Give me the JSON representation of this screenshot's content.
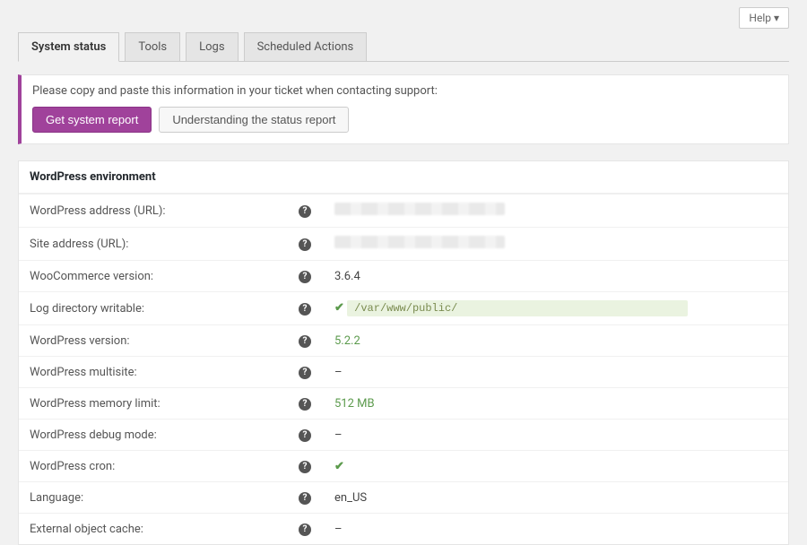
{
  "help_label": "Help ▾",
  "tabs": {
    "system_status": "System status",
    "tools": "Tools",
    "logs": "Logs",
    "scheduled_actions": "Scheduled Actions"
  },
  "notice": {
    "text": "Please copy and paste this information in your ticket when contacting support:",
    "get_report": "Get system report",
    "understanding": "Understanding the status report"
  },
  "panel_title": "WordPress environment",
  "rows": {
    "wp_address": {
      "label": "WordPress address (URL):",
      "value": ""
    },
    "site_address": {
      "label": "Site address (URL):",
      "value": ""
    },
    "wc_version": {
      "label": "WooCommerce version:",
      "value": "3.6.4"
    },
    "log_dir": {
      "label": "Log directory writable:",
      "value": "/var/www/public/"
    },
    "wp_version": {
      "label": "WordPress version:",
      "value": "5.2.2"
    },
    "wp_multisite": {
      "label": "WordPress multisite:",
      "value": "–"
    },
    "wp_memory": {
      "label": "WordPress memory limit:",
      "value": "512 MB"
    },
    "wp_debug": {
      "label": "WordPress debug mode:",
      "value": "–"
    },
    "wp_cron": {
      "label": "WordPress cron:",
      "value": "✔"
    },
    "language": {
      "label": "Language:",
      "value": "en_US"
    },
    "ext_cache": {
      "label": "External object cache:",
      "value": "–"
    }
  }
}
